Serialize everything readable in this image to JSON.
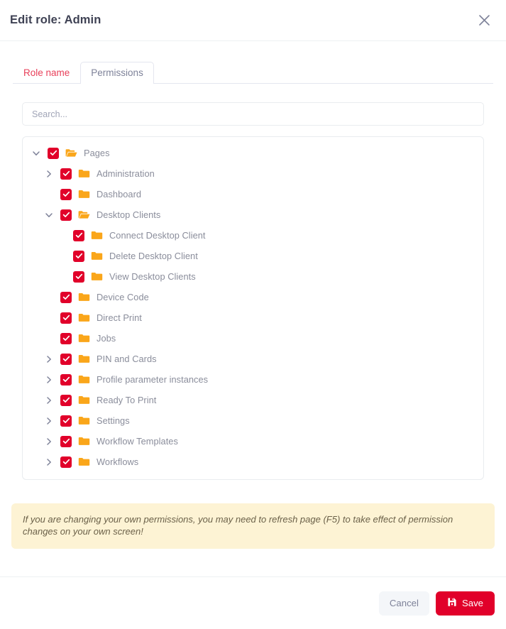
{
  "header": {
    "title": "Edit role: Admin",
    "close_icon": "close-icon"
  },
  "tabs": [
    {
      "label": "Role name",
      "active": false
    },
    {
      "label": "Permissions",
      "active": true
    }
  ],
  "search": {
    "placeholder": "Search...",
    "value": ""
  },
  "colors": {
    "checkbox_red": "#e1002a",
    "folder_orange": "#faa61a",
    "tab_inactive_red": "#e8405a",
    "warning_bg": "#fdf3d4",
    "node_text": "#8a8d9b"
  },
  "tree": {
    "nodes": [
      {
        "label": "Pages",
        "level": 0,
        "checked": true,
        "toggle": "expanded",
        "folder": "folder-open-icon"
      },
      {
        "label": "Administration",
        "level": 1,
        "checked": true,
        "toggle": "collapsed",
        "folder": "folder-icon"
      },
      {
        "label": "Dashboard",
        "level": 1,
        "checked": true,
        "toggle": "none",
        "folder": "folder-icon"
      },
      {
        "label": "Desktop Clients",
        "level": 1,
        "checked": true,
        "toggle": "expanded",
        "folder": "folder-open-icon"
      },
      {
        "label": "Connect Desktop Client",
        "level": 2,
        "checked": true,
        "toggle": "none",
        "folder": "folder-icon"
      },
      {
        "label": "Delete Desktop Client",
        "level": 2,
        "checked": true,
        "toggle": "none",
        "folder": "folder-icon"
      },
      {
        "label": "View Desktop Clients",
        "level": 2,
        "checked": true,
        "toggle": "none",
        "folder": "folder-icon"
      },
      {
        "label": "Device Code",
        "level": 1,
        "checked": true,
        "toggle": "none",
        "folder": "folder-icon"
      },
      {
        "label": "Direct Print",
        "level": 1,
        "checked": true,
        "toggle": "none",
        "folder": "folder-icon"
      },
      {
        "label": "Jobs",
        "level": 1,
        "checked": true,
        "toggle": "none",
        "folder": "folder-icon"
      },
      {
        "label": "PIN and Cards",
        "level": 1,
        "checked": true,
        "toggle": "collapsed",
        "folder": "folder-icon"
      },
      {
        "label": "Profile parameter instances",
        "level": 1,
        "checked": true,
        "toggle": "collapsed",
        "folder": "folder-icon"
      },
      {
        "label": "Ready To Print",
        "level": 1,
        "checked": true,
        "toggle": "collapsed",
        "folder": "folder-icon"
      },
      {
        "label": "Settings",
        "level": 1,
        "checked": true,
        "toggle": "collapsed",
        "folder": "folder-icon"
      },
      {
        "label": "Workflow Templates",
        "level": 1,
        "checked": true,
        "toggle": "collapsed",
        "folder": "folder-icon"
      },
      {
        "label": "Workflows",
        "level": 1,
        "checked": true,
        "toggle": "collapsed",
        "folder": "folder-icon"
      }
    ]
  },
  "warning": {
    "text": "If you are changing your own permissions, you may need to refresh page (F5) to take effect of permission changes on your own screen!"
  },
  "footer": {
    "cancel_label": "Cancel",
    "save_label": "Save",
    "save_icon": "save-icon"
  }
}
